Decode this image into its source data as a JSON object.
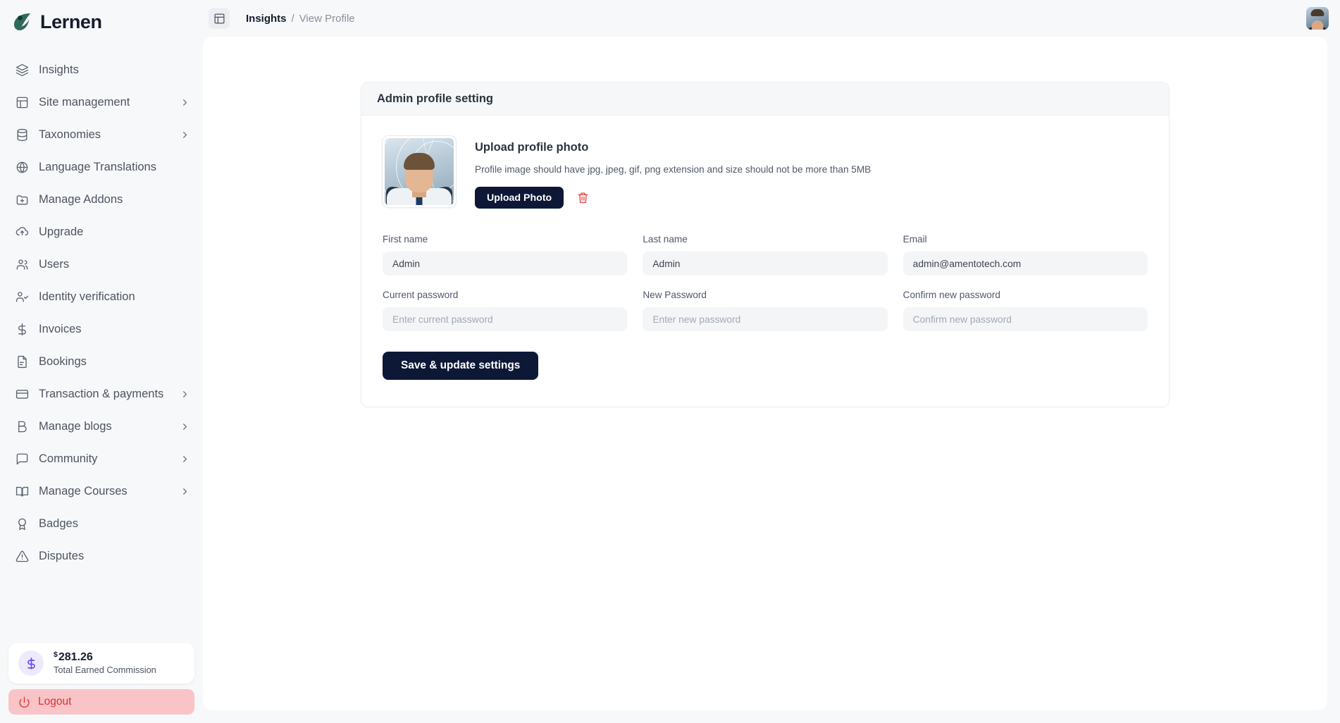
{
  "brand": {
    "name": "Lernen",
    "logo_icon": "leaf-logo-icon"
  },
  "topbar": {
    "panel_toggle_icon": "panel-layout-icon",
    "breadcrumb": {
      "root": "Insights",
      "separator": "/",
      "current": "View Profile"
    },
    "avatar_alt": "user-avatar"
  },
  "sidebar": {
    "items": [
      {
        "label": "Insights",
        "icon": "layers-icon",
        "chevron": false
      },
      {
        "label": "Site management",
        "icon": "layout-panel-icon",
        "chevron": true
      },
      {
        "label": "Taxonomies",
        "icon": "database-icon",
        "chevron": true
      },
      {
        "label": "Language Translations",
        "icon": "globe-icon",
        "chevron": false
      },
      {
        "label": "Manage Addons",
        "icon": "folder-plus-icon",
        "chevron": false
      },
      {
        "label": "Upgrade",
        "icon": "cloud-upload-icon",
        "chevron": false
      },
      {
        "label": "Users",
        "icon": "users-icon",
        "chevron": false
      },
      {
        "label": "Identity verification",
        "icon": "user-check-icon",
        "chevron": false
      },
      {
        "label": "Invoices",
        "icon": "dollar-icon",
        "chevron": false
      },
      {
        "label": "Bookings",
        "icon": "file-text-icon",
        "chevron": false
      },
      {
        "label": "Transaction & payments",
        "icon": "credit-card-icon",
        "chevron": true
      },
      {
        "label": "Manage blogs",
        "icon": "blog-icon",
        "chevron": true
      },
      {
        "label": "Community",
        "icon": "message-square-icon",
        "chevron": true
      },
      {
        "label": "Manage Courses",
        "icon": "book-open-icon",
        "chevron": true
      },
      {
        "label": "Badges",
        "icon": "award-icon",
        "chevron": false
      },
      {
        "label": "Disputes",
        "icon": "alert-triangle-icon",
        "chevron": false
      }
    ],
    "commission": {
      "currency": "$",
      "amount": "281.26",
      "label": "Total Earned Commission",
      "icon": "dollar-circle-icon",
      "accent": "#6d4aff"
    },
    "logout": {
      "label": "Logout",
      "icon": "power-icon",
      "color": "#e03030",
      "background": "#f9c4c8"
    }
  },
  "card": {
    "title": "Admin profile setting",
    "photo": {
      "heading": "Upload profile photo",
      "description": "Profile image should have jpg, jpeg, gif, png extension and size should not be more than 5MB",
      "upload_button": "Upload Photo",
      "delete_icon": "trash-icon"
    },
    "fields": [
      {
        "label": "First name",
        "value": "Admin",
        "placeholder": "",
        "type": "text"
      },
      {
        "label": "Last name",
        "value": "Admin",
        "placeholder": "",
        "type": "text"
      },
      {
        "label": "Email",
        "value": "admin@amentotech.com",
        "placeholder": "",
        "type": "text"
      },
      {
        "label": "Current password",
        "value": "",
        "placeholder": "Enter current password",
        "type": "password"
      },
      {
        "label": "New Password",
        "value": "",
        "placeholder": "Enter new password",
        "type": "password"
      },
      {
        "label": "Confirm new password",
        "value": "",
        "placeholder": "Confirm new password",
        "type": "password"
      }
    ],
    "save_button": "Save & update settings"
  },
  "colors": {
    "primary_dark": "#0d1836",
    "page_bg": "#f7f8f9",
    "card_bg": "#ffffff",
    "input_bg": "#f4f5f6",
    "danger": "#e7413b"
  }
}
